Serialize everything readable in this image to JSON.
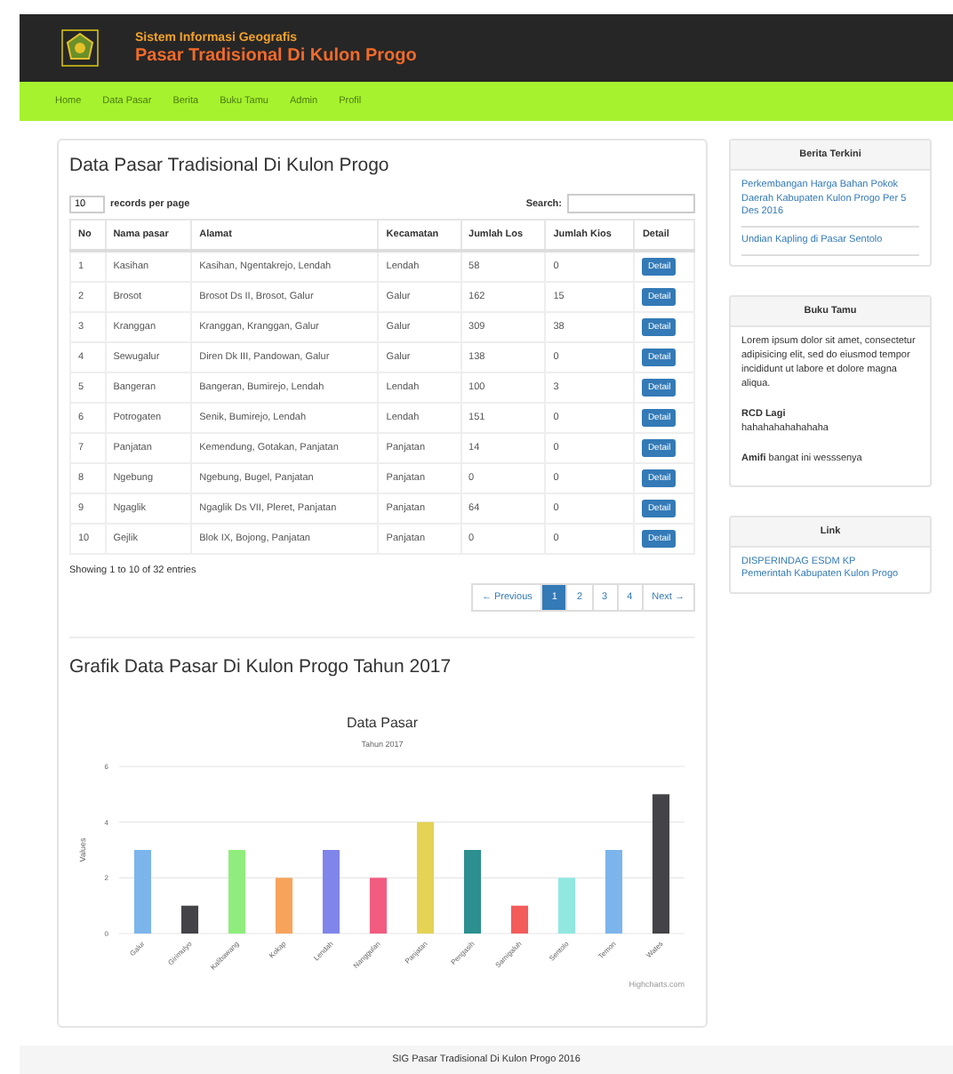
{
  "header": {
    "subtitle": "Sistem Informasi Geografis",
    "title": "Pasar Tradisional Di Kulon Progo"
  },
  "nav": [
    "Home",
    "Data Pasar",
    "Berita",
    "Buku Tamu",
    "Admin",
    "Profil"
  ],
  "table_panel": {
    "title": "Data Pasar Tradisional Di Kulon Progo",
    "page_size": "10",
    "page_size_label": "records per page",
    "search_label": "Search:",
    "columns": [
      "No",
      "Nama pasar",
      "Alamat",
      "Kecamatan",
      "Jumlah Los",
      "Jumlah Kios",
      "Detail"
    ],
    "rows": [
      {
        "cells": [
          "1",
          "Kasihan",
          "Kasihan, Ngentakrejo, Lendah",
          "Lendah",
          "58",
          "0"
        ],
        "action": "Detail"
      },
      {
        "cells": [
          "2",
          "Brosot",
          "Brosot Ds II, Brosot, Galur",
          "Galur",
          "162",
          "15"
        ],
        "action": "Detail"
      },
      {
        "cells": [
          "3",
          "Kranggan",
          "Kranggan, Kranggan, Galur",
          "Galur",
          "309",
          "38"
        ],
        "action": "Detail"
      },
      {
        "cells": [
          "4",
          "Sewugalur",
          "Diren Dk III, Pandowan, Galur",
          "Galur",
          "138",
          "0"
        ],
        "action": "Detail"
      },
      {
        "cells": [
          "5",
          "Bangeran",
          "Bangeran, Bumirejo, Lendah",
          "Lendah",
          "100",
          "3"
        ],
        "action": "Detail"
      },
      {
        "cells": [
          "6",
          "Potrogaten",
          "Senik, Bumirejo, Lendah",
          "Lendah",
          "151",
          "0"
        ],
        "action": "Detail"
      },
      {
        "cells": [
          "7",
          "Panjatan",
          "Kemendung, Gotakan, Panjatan",
          "Panjatan",
          "14",
          "0"
        ],
        "action": "Detail"
      },
      {
        "cells": [
          "8",
          "Ngebung",
          "Ngebung, Bugel, Panjatan",
          "Panjatan",
          "0",
          "0"
        ],
        "action": "Detail"
      },
      {
        "cells": [
          "9",
          "Ngaglik",
          "Ngaglik Ds VII, Pleret, Panjatan",
          "Panjatan",
          "64",
          "0"
        ],
        "action": "Detail"
      },
      {
        "cells": [
          "10",
          "Gejlik",
          "Blok IX, Bojong, Panjatan",
          "Panjatan",
          "0",
          "0"
        ],
        "action": "Detail"
      }
    ],
    "info": "Showing 1 to 10 of 32 entries",
    "pagination": [
      {
        "label": "← Previous",
        "selected": false
      },
      {
        "label": "1",
        "selected": true
      },
      {
        "label": "2",
        "selected": false
      },
      {
        "label": "3",
        "selected": false
      },
      {
        "label": "4",
        "selected": false
      },
      {
        "label": "Next →",
        "selected": false
      }
    ]
  },
  "chart_panel": {
    "heading": "Grafik Data Pasar Di Kulon Progo Tahun 2017",
    "credit": "Highcharts.com",
    "chart_data": {
      "type": "bar",
      "title": "Data Pasar",
      "subtitle": "Tahun 2017",
      "ylabel": "Values",
      "categories": [
        "Galur",
        "Girimulyo",
        "Kalibawang",
        "Kokap",
        "Lendah",
        "Nanggulan",
        "Panjatan",
        "Pengasih",
        "Samigaluh",
        "Sentolo",
        "Temon",
        "Wates"
      ],
      "values": [
        3,
        1,
        3,
        2,
        3,
        2,
        4,
        3,
        1,
        2,
        3,
        5
      ],
      "colors": [
        "#7cb5ec",
        "#434348",
        "#90ed7d",
        "#f7a35c",
        "#8085e9",
        "#f15c80",
        "#e4d354",
        "#2b908f",
        "#f45b5b",
        "#91e8e1",
        "#7cb5ec",
        "#434348"
      ],
      "ylim": [
        0,
        6
      ],
      "yticks": [
        0,
        2,
        4,
        6
      ]
    }
  },
  "sidebar": {
    "news": {
      "title": "Berita Terkini",
      "links": [
        "Perkembangan Harga Bahan Pokok Daerah Kabupaten Kulon Progo Per 5 Des 2016",
        "Undian Kapling di Pasar Sentolo"
      ]
    },
    "guestbook": {
      "title": "Buku Tamu",
      "entries": [
        {
          "message": "Lorem ipsum dolor sit amet, consectetur adipisicing elit, sed do eiusmod tempor incididunt ut labore et dolore magna aliqua."
        },
        {
          "name": "RCD Lagi",
          "message": "hahahahahahahaha"
        },
        {
          "name": "Amifi",
          "message": "bangat ini wesssenya"
        }
      ]
    },
    "links": {
      "title": "Link",
      "links": [
        "DISPERINDAG ESDM KP",
        "Pemerintah Kabupaten Kulon Progo"
      ]
    }
  },
  "footer": "SIG Pasar Tradisional Di Kulon Progo 2016"
}
